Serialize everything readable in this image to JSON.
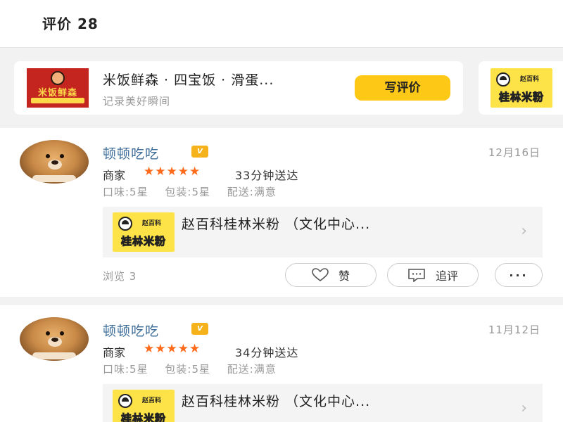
{
  "header": {
    "title": "评价 28"
  },
  "shop": {
    "logo_text": "米饭鲜森",
    "name": "米饭鲜森 · 四宝饭 · 滑蛋...",
    "subtitle": "记录美好瞬间",
    "write_review_label": "写评价"
  },
  "brand_logo": {
    "small_text": "赵百科",
    "big_text": "桂林米粉"
  },
  "reviews": [
    {
      "user": "顿顿吃吃",
      "badge": "V",
      "date": "12月16日",
      "role": "商家",
      "stars": "★★★★★",
      "delivery": "33分钟送达",
      "taste": "口味:5星",
      "packaging": "包装:5星",
      "delivery_rating": "配送:满意",
      "store_name": "赵百科桂林米粉 （文化中心...",
      "views": "浏览 3",
      "like_label": "赞",
      "follow_label": "追评",
      "more_label": "···"
    },
    {
      "user": "顿顿吃吃",
      "badge": "V",
      "date": "11月12日",
      "role": "商家",
      "stars": "★★★★★",
      "delivery": "34分钟送达",
      "taste": "口味:5星",
      "packaging": "包装:5星",
      "delivery_rating": "配送:满意",
      "store_name": "赵百科桂林米粉 （文化中心..."
    }
  ],
  "colors": {
    "accent_yellow": "#fdc916",
    "star_orange": "#ff6b1a",
    "username_blue": "#3e6e99"
  }
}
